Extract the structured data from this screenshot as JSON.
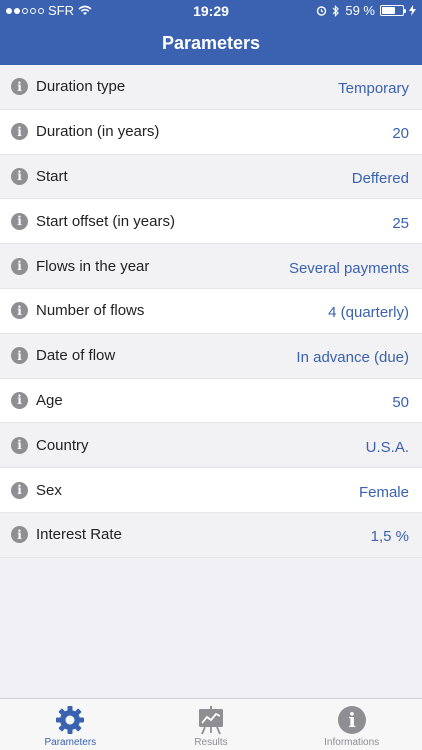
{
  "status_bar": {
    "carrier": "SFR",
    "time": "19:29",
    "battery_text": "59 %",
    "battery_level": 0.59,
    "icons": [
      "signal-icon",
      "wifi-icon",
      "alarm-icon",
      "bluetooth-icon",
      "battery-icon",
      "charging-icon"
    ]
  },
  "header": {
    "title": "Parameters"
  },
  "rows": [
    {
      "label": "Duration type",
      "value": "Temporary"
    },
    {
      "label": "Duration (in years)",
      "value": "20"
    },
    {
      "label": "Start",
      "value": "Deffered"
    },
    {
      "label": "Start offset (in years)",
      "value": "25"
    },
    {
      "label": "Flows in the year",
      "value": "Several payments"
    },
    {
      "label": "Number of flows",
      "value": "4 (quarterly)"
    },
    {
      "label": "Date of flow",
      "value": "In advance (due)"
    },
    {
      "label": "Age",
      "value": "50"
    },
    {
      "label": "Country",
      "value": "U.S.A."
    },
    {
      "label": "Sex",
      "value": "Female"
    },
    {
      "label": "Interest Rate",
      "value": "1,5 %"
    }
  ],
  "tabbar": {
    "tabs": [
      {
        "label": "Parameters",
        "icon": "gear-icon",
        "active": true
      },
      {
        "label": "Results",
        "icon": "chart-board-icon",
        "active": false
      },
      {
        "label": "Informations",
        "icon": "info-icon",
        "active": false
      }
    ]
  },
  "colors": {
    "accent": "#3a62b0",
    "inactive": "#8e8e93"
  }
}
